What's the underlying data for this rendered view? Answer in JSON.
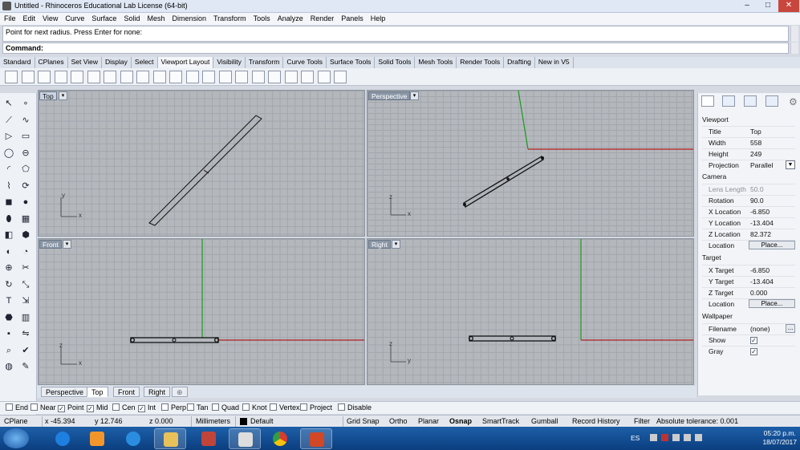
{
  "window": {
    "title": "Untitled - Rhinoceros Educational Lab License (64-bit)",
    "min": "–",
    "max": "□",
    "close": "✕"
  },
  "menu": [
    "File",
    "Edit",
    "View",
    "Curve",
    "Surface",
    "Solid",
    "Mesh",
    "Dimension",
    "Transform",
    "Tools",
    "Analyze",
    "Render",
    "Panels",
    "Help"
  ],
  "command": {
    "history": "Point for next radius. Press Enter for none:",
    "prompt": "Command:"
  },
  "toolbar_tabs": [
    "Standard",
    "CPlanes",
    "Set View",
    "Display",
    "Select",
    "Viewport Layout",
    "Visibility",
    "Transform",
    "Curve Tools",
    "Surface Tools",
    "Solid Tools",
    "Mesh Tools",
    "Render Tools",
    "Drafting",
    "New in V5"
  ],
  "toolbar_active_tab": "Viewport Layout",
  "viewports": {
    "top": {
      "label": "Top",
      "axis_y": "y",
      "axis_x": "x"
    },
    "perspective": {
      "label": "Perspective",
      "axis_y": "z",
      "axis_x": "x"
    },
    "front": {
      "label": "Front",
      "axis_y": "z",
      "axis_x": "x"
    },
    "right": {
      "label": "Right",
      "axis_y": "z",
      "axis_x": "y"
    },
    "dropdown": "▾"
  },
  "viewport_tabs": [
    "Perspective",
    "Top",
    "Front",
    "Right"
  ],
  "viewport_tab_active": "Top",
  "viewport_tab_add": "⊕",
  "osnap": [
    {
      "label": "End",
      "checked": false
    },
    {
      "label": "Near",
      "checked": false
    },
    {
      "label": "Point",
      "checked": true
    },
    {
      "label": "Mid",
      "checked": true
    },
    {
      "label": "Cen",
      "checked": false
    },
    {
      "label": "Int",
      "checked": true
    },
    {
      "label": "Perp",
      "checked": false
    },
    {
      "label": "Tan",
      "checked": false
    },
    {
      "label": "Quad",
      "checked": false
    },
    {
      "label": "Knot",
      "checked": false
    },
    {
      "label": "Vertex",
      "checked": false
    },
    {
      "label": "Project",
      "checked": false
    },
    {
      "label": "Disable",
      "checked": false
    }
  ],
  "status": {
    "cplane": "CPlane",
    "x": "x -45.394",
    "y": "y 12.746",
    "z": "z 0.000",
    "units": "Millimeters",
    "layer": "Default",
    "grid_snap": "Grid Snap",
    "ortho": "Ortho",
    "planar": "Planar",
    "osnap": "Osnap",
    "smarttrack": "SmartTrack",
    "gumball": "Gumball",
    "record_history": "Record History",
    "filter": "Filter",
    "tolerance": "Absolute tolerance: 0.001"
  },
  "properties": {
    "viewport_header": "Viewport",
    "title_k": "Title",
    "title_v": "Top",
    "width_k": "Width",
    "width_v": "558",
    "height_k": "Height",
    "height_v": "249",
    "projection_k": "Projection",
    "projection_v": "Parallel",
    "camera_header": "Camera",
    "lens_k": "Lens Length",
    "lens_v": "50.0",
    "rotation_k": "Rotation",
    "rotation_v": "90.0",
    "xloc_k": "X Location",
    "xloc_v": "-6.850",
    "yloc_k": "Y Location",
    "yloc_v": "-13.404",
    "zloc_k": "Z Location",
    "zloc_v": "82.372",
    "location_k": "Location",
    "place_btn": "Place...",
    "target_header": "Target",
    "xt_k": "X Target",
    "xt_v": "-6.850",
    "yt_k": "Y Target",
    "yt_v": "-13.404",
    "zt_k": "Z Target",
    "zt_v": "0.000",
    "tloc_k": "Location",
    "tplace_btn": "Place...",
    "wallpaper_header": "Wallpaper",
    "filename_k": "Filename",
    "filename_v": "(none)",
    "browse_btn": "...",
    "show_k": "Show",
    "show_v": true,
    "gray_k": "Gray",
    "gray_v": true
  },
  "taskbar": {
    "lang": "ES",
    "time": "05:20 p.m.",
    "date": "18/07/2017"
  },
  "colors": {
    "x_axis": "#b01e1e",
    "y_axis": "#1a9a1a",
    "grid": "#a3a7ad",
    "viewport_bg": "#b4b8bd"
  }
}
